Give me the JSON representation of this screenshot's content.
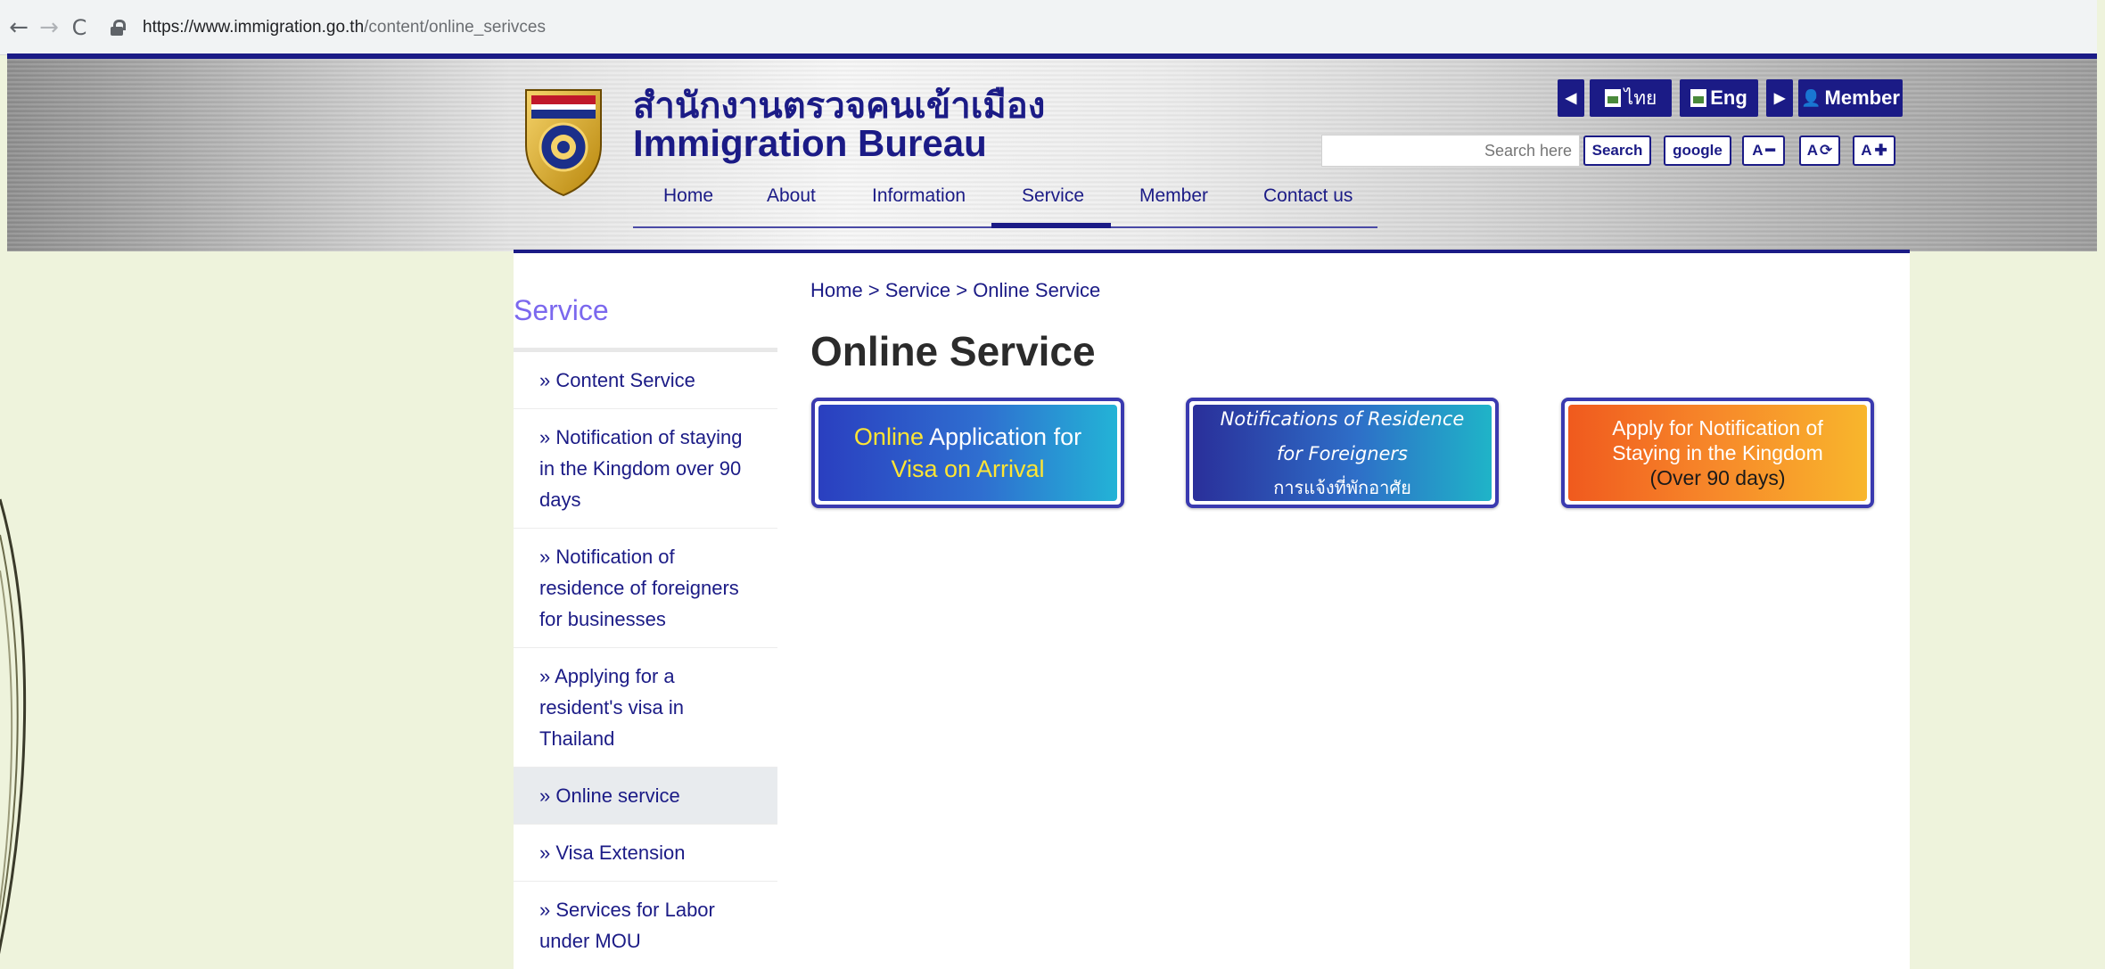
{
  "browser": {
    "back_icon": "arrow-left-icon",
    "forward_icon": "arrow-right-icon",
    "reload_icon": "reload-icon",
    "url_host": "https://www.immigration.go.th",
    "url_path": "/content/online_serivces"
  },
  "header": {
    "title_th": "สำนักงานตรวจคนเข้าเมือง",
    "title_en": "Immigration Bureau",
    "lang_thai": "ไทย",
    "lang_eng": "Eng",
    "member": "Member",
    "search_placeholder": "Search here",
    "search_button": "Search",
    "google_button": "google",
    "font_decrease": "A",
    "font_reset": "A",
    "font_increase": "A"
  },
  "nav": {
    "items": [
      "Home",
      "About",
      "Information",
      "Service",
      "Member",
      "Contact us"
    ],
    "active": "Service"
  },
  "sidebar": {
    "title": "Service",
    "items": [
      "» Content Service",
      "» Notification of staying in the Kingdom over 90 days",
      "» Notification of residence of foreigners for businesses",
      "» Applying for a resident's visa in Thailand",
      "» Online service",
      "» Visa Extension",
      "» Services for Labor under MOU"
    ],
    "active_index": 4
  },
  "main": {
    "breadcrumb": "Home > Service  > Online Service",
    "title": "Online Service",
    "cards": {
      "voa": {
        "word1": "Online",
        "rest1": " Application for",
        "line2": "Visa on Arrival"
      },
      "residence": {
        "line1": "Notifications of Residence",
        "line2": "for Foreigners",
        "line3": "การแจ้งที่พักอาศัย"
      },
      "ninety": {
        "line1": "Apply for Notification of",
        "line2": "Staying in the Kingdom",
        "line3": "(Over 90 days)"
      }
    }
  },
  "colors": {
    "brand_navy": "#1b1b86",
    "sidebar_title": "#7b68ee",
    "active_bg": "#e8ebee"
  }
}
